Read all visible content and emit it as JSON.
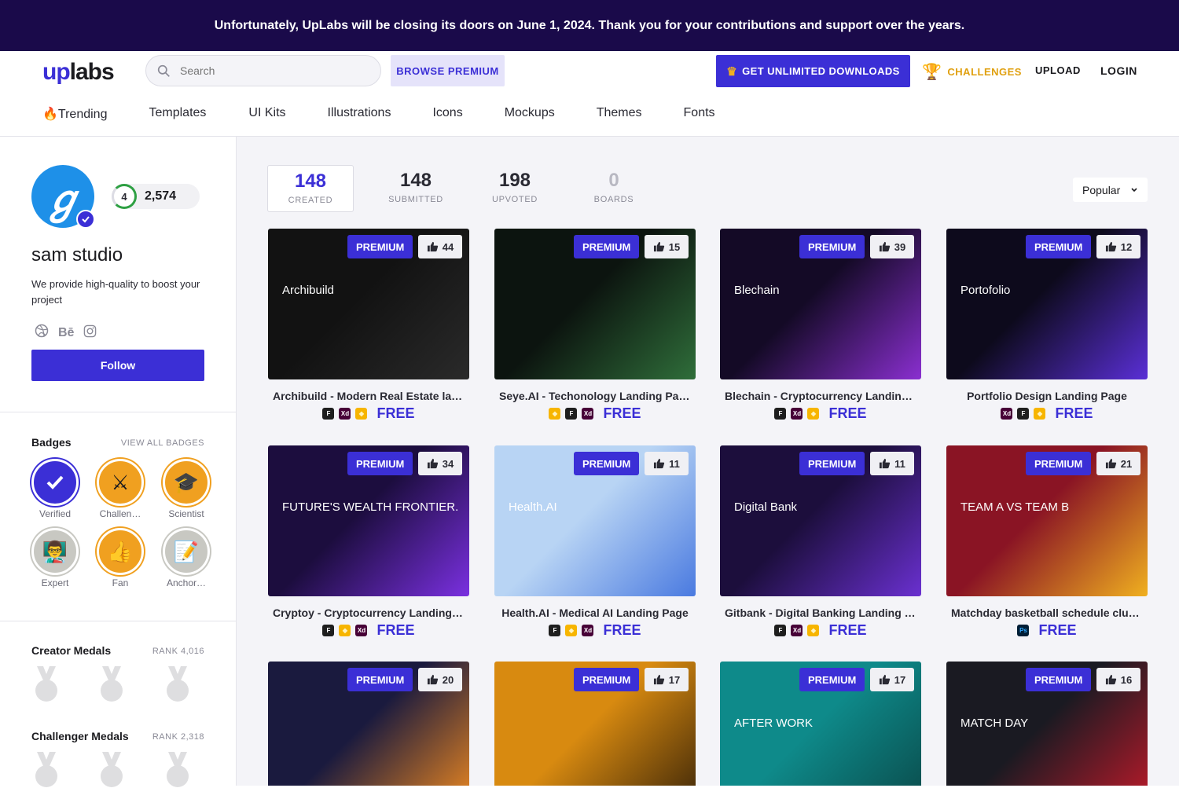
{
  "banner": {
    "text": "Unfortunately, UpLabs will be closing its doors on June 1, 2024. Thank you for your contributions and support over the years."
  },
  "header": {
    "logo_up": "up",
    "logo_labs": "labs",
    "search_placeholder": "Search",
    "browse_premium": "BROWSE PREMIUM",
    "get_unlimited": "GET UNLIMITED DOWNLOADS",
    "challenges": "CHALLENGES",
    "upload": "UPLOAD",
    "login": "LOGIN"
  },
  "nav": [
    "Trending",
    "Templates",
    "UI Kits",
    "Illustrations",
    "Icons",
    "Mockups",
    "Themes",
    "Fonts"
  ],
  "profile": {
    "level": "4",
    "points": "2,574",
    "name": "sam studio",
    "bio": "We provide high-quality to boost your project",
    "behance": "Bē",
    "follow": "Follow"
  },
  "badges": {
    "title": "Badges",
    "view_all": "VIEW ALL BADGES",
    "items": [
      {
        "label": "Verified",
        "color": "#3b2fd6"
      },
      {
        "label": "Challen…",
        "color": "#f0a020"
      },
      {
        "label": "Scientist",
        "color": "#f0a020"
      },
      {
        "label": "Expert",
        "color": "#c8c8c2"
      },
      {
        "label": "Fan",
        "color": "#f0a020"
      },
      {
        "label": "Anchor…",
        "color": "#c8c8c2"
      }
    ]
  },
  "creator_medals": {
    "title": "Creator Medals",
    "rank": "RANK 4,016"
  },
  "challenger_medals": {
    "title": "Challenger Medals",
    "rank": "RANK 2,318"
  },
  "stats": [
    {
      "num": "148",
      "label": "CREATED"
    },
    {
      "num": "148",
      "label": "SUBMITTED"
    },
    {
      "num": "198",
      "label": "UPVOTED"
    },
    {
      "num": "0",
      "label": "BOARDS"
    }
  ],
  "sort": "Popular",
  "premium_label": "PREMIUM",
  "free_label": "FREE",
  "cards": [
    {
      "title": "Archibuild - Modern Real Estate lan…",
      "likes": "44",
      "thumb_text": "Archibuild",
      "bg": "#121212",
      "accent": "#2a2a2a",
      "tools": [
        "figma",
        "xd",
        "sketch"
      ]
    },
    {
      "title": "Seye.AI - Techonology Landing Page",
      "likes": "15",
      "thumb_text": "",
      "bg": "#0c140f",
      "accent": "#2f6e3a",
      "tools": [
        "sketch",
        "figma",
        "xd"
      ]
    },
    {
      "title": "Blechain - Cryptocurrency Landing P…",
      "likes": "39",
      "thumb_text": "Blechain",
      "bg": "#140a26",
      "accent": "#8a2fd0",
      "tools": [
        "figma",
        "xd",
        "sketch"
      ]
    },
    {
      "title": "Portfolio Design Landing Page",
      "likes": "12",
      "thumb_text": "Portofolio",
      "bg": "#0d0a1c",
      "accent": "#5a2fd6",
      "tools": [
        "xd",
        "figma",
        "sketch"
      ]
    },
    {
      "title": "Cryptoy - Cryptocurrency Landing …",
      "likes": "34",
      "thumb_text": "FUTURE'S WEALTH FRONTIER.",
      "bg": "#1c0d3e",
      "accent": "#7a30e0",
      "tools": [
        "figma",
        "sketch",
        "xd"
      ]
    },
    {
      "title": "Health.AI - Medical AI Landing Page",
      "likes": "11",
      "thumb_text": "Health.AI",
      "bg": "#b8d4f4",
      "accent": "#4a7ae0",
      "tools": [
        "figma",
        "sketch",
        "xd"
      ]
    },
    {
      "title": "Gitbank - Digital Banking Landing P…",
      "likes": "11",
      "thumb_text": "Digital Bank",
      "bg": "#1c0e3c",
      "accent": "#6a30d0",
      "tools": [
        "figma",
        "xd",
        "sketch"
      ]
    },
    {
      "title": "Matchday basketball schedule club …",
      "likes": "21",
      "thumb_text": "TEAM A VS TEAM B",
      "bg": "#8a1424",
      "accent": "#f0b020",
      "tools": [
        "ps"
      ]
    },
    {
      "title": "",
      "likes": "20",
      "thumb_text": "",
      "bg": "#1a1a3e",
      "accent": "#f08a20",
      "tools": []
    },
    {
      "title": "",
      "likes": "17",
      "thumb_text": "",
      "bg": "#d88a10",
      "accent": "#3a2408",
      "tools": []
    },
    {
      "title": "",
      "likes": "17",
      "thumb_text": "AFTER WORK",
      "bg": "#0e8a8a",
      "accent": "#0a4a4a",
      "tools": []
    },
    {
      "title": "",
      "likes": "16",
      "thumb_text": "MATCH DAY",
      "bg": "#1a1a22",
      "accent": "#c01a2a",
      "tools": []
    }
  ]
}
